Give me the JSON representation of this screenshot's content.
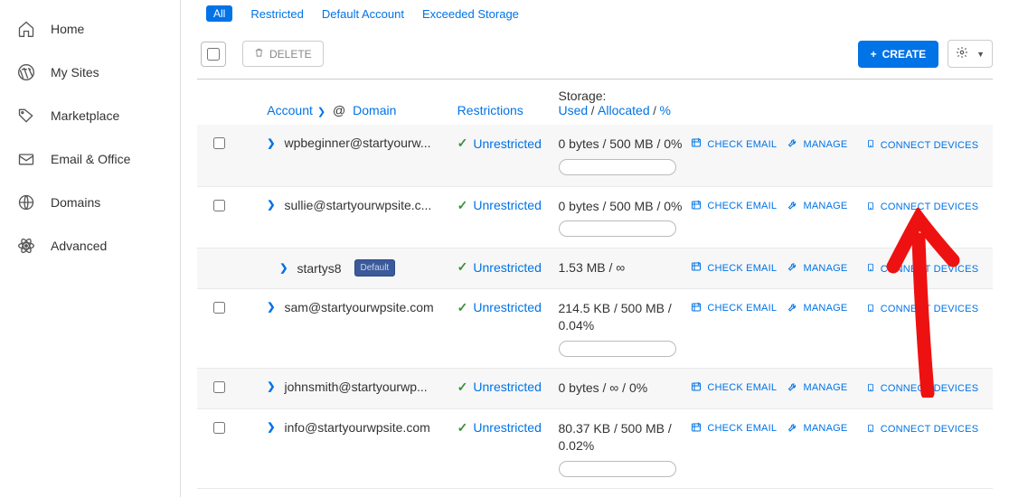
{
  "sidebar": {
    "items": [
      {
        "label": "Home",
        "icon": "home"
      },
      {
        "label": "My Sites",
        "icon": "wordpress"
      },
      {
        "label": "Marketplace",
        "icon": "tag"
      },
      {
        "label": "Email & Office",
        "icon": "mail"
      },
      {
        "label": "Domains",
        "icon": "globe"
      },
      {
        "label": "Advanced",
        "icon": "atom"
      }
    ]
  },
  "filters": {
    "all": "All",
    "restricted": "Restricted",
    "default_account": "Default Account",
    "exceeded": "Exceeded Storage"
  },
  "toolbar": {
    "delete": "DELETE",
    "create": "CREATE"
  },
  "columns": {
    "account": "Account",
    "at": "@",
    "domain": "Domain",
    "restrictions": "Restrictions",
    "storage": "Storage:",
    "used": "Used",
    "allocated": "Allocated",
    "pct": "%"
  },
  "action_labels": {
    "check": "CHECK EMAIL",
    "manage": "MANAGE",
    "connect": "CONNECT DEVICES"
  },
  "restriction_text": "Unrestricted",
  "storage_sep": " / ",
  "rows": [
    {
      "account": "wpbeginner@startyourw...",
      "storage": "0 bytes / 500 MB / 0%",
      "meter": true,
      "bg": "alt1",
      "default": false
    },
    {
      "account": "sullie@startyourwpsite.c...",
      "storage": "0 bytes / 500 MB / 0%",
      "meter": true,
      "bg": "white",
      "default": false
    },
    {
      "account": "startys8",
      "storage": "1.53 MB / ∞",
      "meter": false,
      "bg": "alt1",
      "default": true,
      "nested": true,
      "nocheckbox": true
    },
    {
      "account": "sam@startyourwpsite.com",
      "storage": "214.5 KB / 500 MB / 0.04%",
      "meter": true,
      "bg": "white",
      "default": false
    },
    {
      "account": "johnsmith@startyourwp...",
      "storage": "0 bytes / ∞ / 0%",
      "meter": false,
      "bg": "alt1",
      "default": false
    },
    {
      "account": "info@startyourwpsite.com",
      "storage": "80.37 KB / 500 MB / 0.02%",
      "meter": true,
      "bg": "white",
      "default": false
    }
  ],
  "default_badge": "Default"
}
